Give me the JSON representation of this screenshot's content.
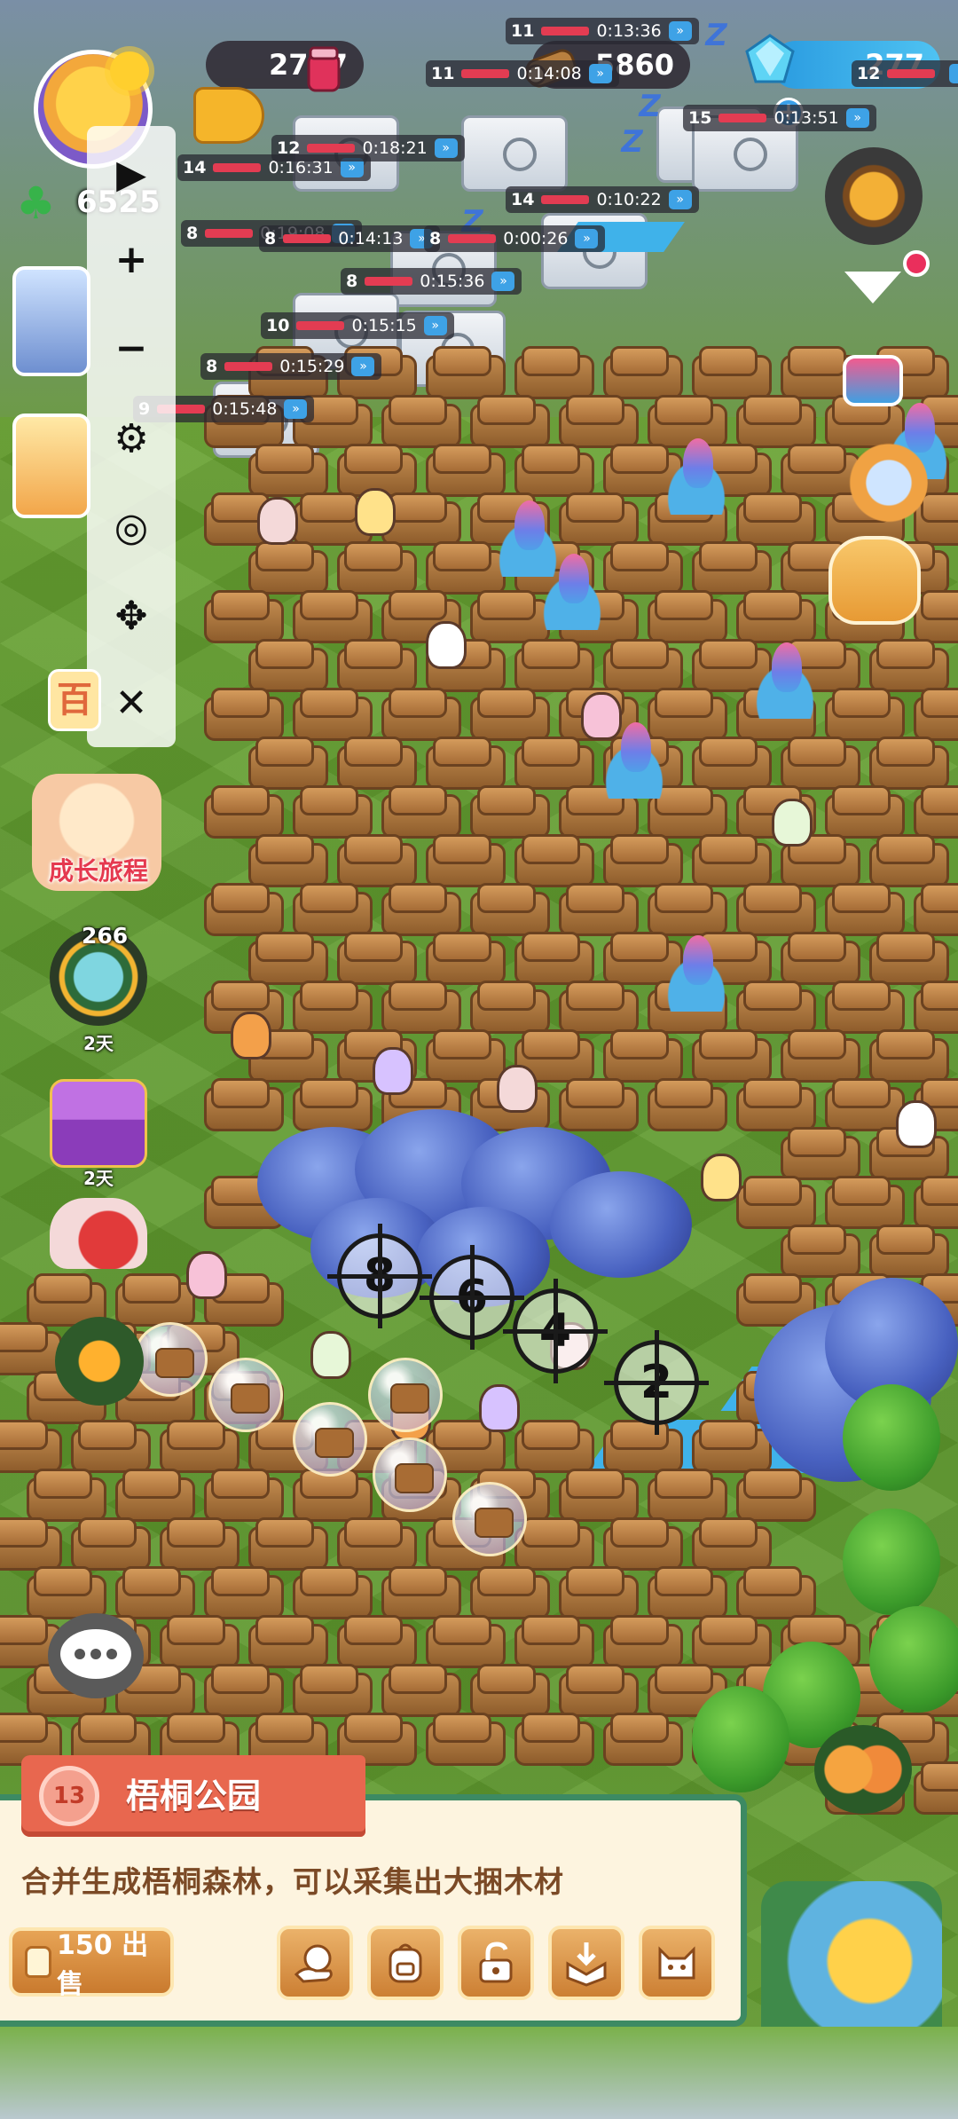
{
  "hud": {
    "jam_count": "2777",
    "wood_count": "5860",
    "gem_count": "277",
    "clover_count": "6525",
    "gem_plus": "+"
  },
  "timers": [
    {
      "level": "11",
      "time": "0:13:36"
    },
    {
      "level": "11",
      "time": "0:14:08"
    },
    {
      "level": "14",
      "time": "0:16:31"
    },
    {
      "level": "8",
      "time": "0:19:08"
    },
    {
      "level": "8",
      "time": "0:14:13"
    },
    {
      "level": "8",
      "time": "0:00:26"
    },
    {
      "level": "14",
      "time": "0:10:22"
    },
    {
      "level": "8",
      "time": "0:15:36"
    },
    {
      "level": "10",
      "time": "0:15:15"
    },
    {
      "level": "8",
      "time": "0:15:29"
    },
    {
      "level": "9",
      "time": "0:15:48"
    },
    {
      "level": "12",
      "time": "0:18:21"
    },
    {
      "level": "15",
      "time": "0:13:51"
    },
    {
      "level": "12",
      "time": ""
    }
  ],
  "editor_toolbar": {
    "play": "▶",
    "zoom_in": "+",
    "zoom_out": "−",
    "settings": "⚙",
    "hide": "◎",
    "move": "✥",
    "close": "✕"
  },
  "side_left": {
    "growth_journey_label": "成长旅程",
    "event_count": "266",
    "event_days": "2天",
    "gift_days": "2天",
    "partial_label": "百"
  },
  "targets": [
    "8",
    "6",
    "4",
    "2"
  ],
  "panel": {
    "level": "13",
    "title": "梧桐公园",
    "description": "合并生成梧桐森林，可以采集出大捆木材",
    "sell_label": "150 出售"
  },
  "colors": {
    "panel_border": "#3d8a63",
    "title_tab": "#e8674f",
    "button_orange": "#cc7f33",
    "description_text": "#7b4a26"
  },
  "icons": {
    "action_buttons": [
      "duck-hand-icon",
      "backpack-icon",
      "unlock-icon",
      "collect-box-icon",
      "cat-face-icon"
    ]
  }
}
